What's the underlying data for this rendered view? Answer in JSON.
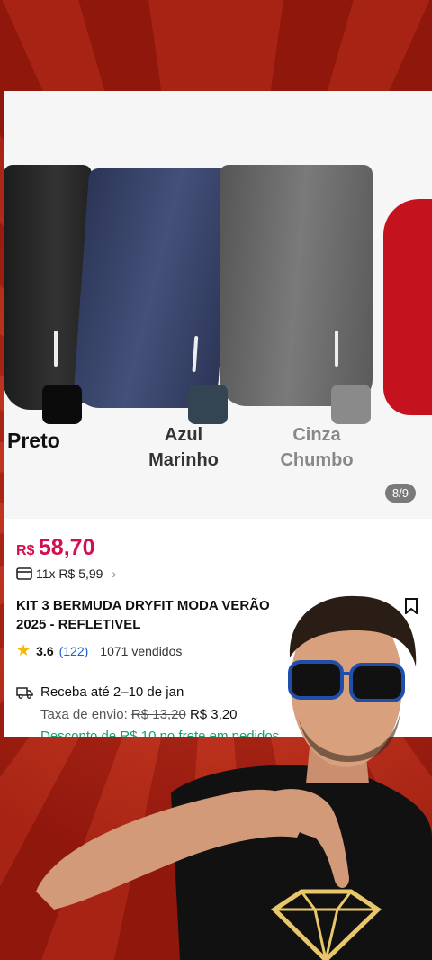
{
  "product": {
    "image_pager": "8/9",
    "colors": [
      {
        "label": "Preto",
        "swatch": "#0b0b0b"
      },
      {
        "label": "Azul\nMarinho",
        "swatch": "#334553"
      },
      {
        "label": "Cinza\nChumbo",
        "swatch": "#8a8a8a"
      }
    ],
    "price_currency": "R$",
    "price_value": "58,70",
    "installments": "11x R$ 5,99",
    "title": "KIT 3 BERMUDA DRYFIT MODA VERÃO 2025 - REFLETIVEL",
    "rating": "3.6",
    "review_count": "(122)",
    "sold": "1071 vendidos",
    "delivery": "Receba até 2–10 de jan",
    "shipping_label": "Taxa de envio:",
    "shipping_old": "R$ 13,20",
    "shipping_new": "R$ 3,20",
    "promo": "Desconto de R$ 10 no frete em pedidos"
  },
  "colors": {
    "price": "#d3104d",
    "link": "#1a5fd1",
    "promo": "#15a06a",
    "background_red": "#c8301f"
  }
}
